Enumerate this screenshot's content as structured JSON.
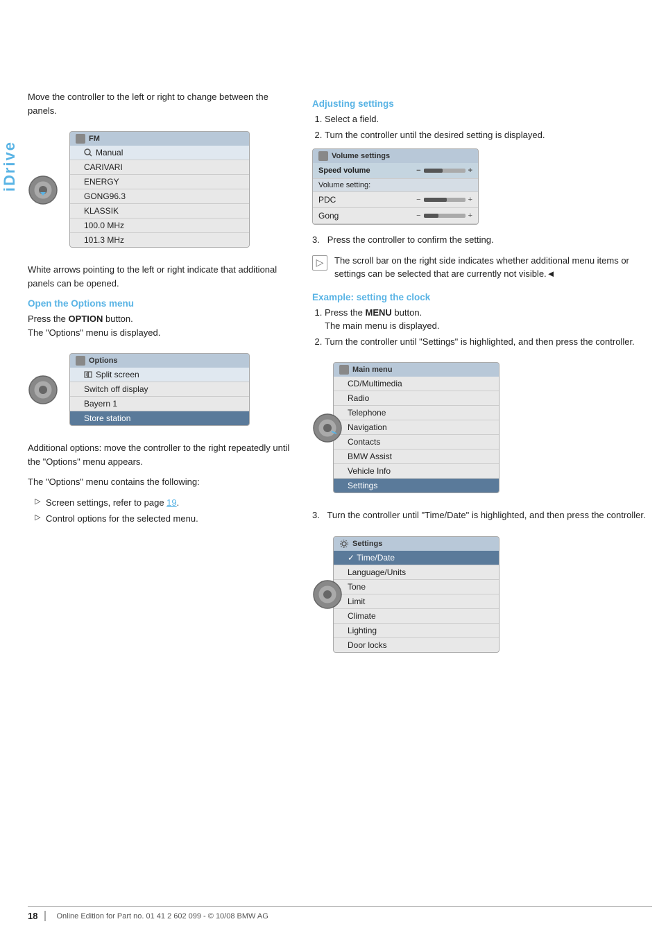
{
  "page": {
    "title": "iDrive",
    "page_number": "18",
    "footer_text": "Online Edition for Part no. 01 41 2 602 099 - © 10/08 BMW AG"
  },
  "left_col": {
    "intro_text": "Move the controller to the left or right to change between the panels.",
    "fm_screen": {
      "title": "FM",
      "rows": [
        {
          "label": "Manual",
          "type": "manual"
        },
        {
          "label": "CARIVARI",
          "type": "normal"
        },
        {
          "label": "ENERGY",
          "type": "normal"
        },
        {
          "label": "GONG96.3",
          "type": "normal"
        },
        {
          "label": "KLASSIK",
          "type": "normal"
        },
        {
          "label": "100.0 MHz",
          "type": "normal"
        },
        {
          "label": "101.3 MHz",
          "type": "normal"
        }
      ]
    },
    "arrows_text": "White arrows pointing to the left or right indicate that additional panels can be opened.",
    "options_section": {
      "heading": "Open the Options menu",
      "para1": "Press the OPTION button.",
      "para2": "The \"Options\" menu is displayed.",
      "options_screen": {
        "title": "Options",
        "rows": [
          {
            "label": "Split screen",
            "type": "icon-row"
          },
          {
            "label": "Switch off display",
            "type": "normal"
          },
          {
            "label": "Bayern 1",
            "type": "normal"
          },
          {
            "label": "Store station",
            "type": "highlighted"
          }
        ]
      },
      "additional_text": "Additional options: move the controller to the right repeatedly until the \"Options\" menu appears.",
      "contains_text": "The \"Options\" menu contains the following:",
      "bullet_items": [
        "Screen settings, refer to page 19.",
        "Control options for the selected menu."
      ]
    }
  },
  "right_col": {
    "adjusting_section": {
      "heading": "Adjusting settings",
      "steps": [
        "Select a field.",
        "Turn the controller until the desired setting is displayed."
      ],
      "volume_screen": {
        "title": "Volume settings",
        "speed_volume_label": "Speed volume",
        "volume_setting_label": "Volume setting:",
        "pdc_label": "PDC",
        "gong_label": "Gong"
      },
      "step3": "Press the controller to confirm the setting.",
      "scroll_note": "The scroll bar on the right side indicates whether additional menu items or settings can be selected that are currently not visible.◄"
    },
    "example_section": {
      "heading": "Example: setting the clock",
      "steps": [
        {
          "text": "Press the MENU button.",
          "sub": "The main menu is displayed."
        },
        {
          "text": "Turn the controller until \"Settings\" is highlighted, and then press the controller.",
          "sub": ""
        }
      ],
      "main_menu_screen": {
        "title": "Main menu",
        "rows": [
          {
            "label": "CD/Multimedia",
            "type": "normal"
          },
          {
            "label": "Radio",
            "type": "normal"
          },
          {
            "label": "Telephone",
            "type": "normal"
          },
          {
            "label": "Navigation",
            "type": "normal"
          },
          {
            "label": "Contacts",
            "type": "normal"
          },
          {
            "label": "BMW Assist",
            "type": "normal"
          },
          {
            "label": "Vehicle Info",
            "type": "normal"
          },
          {
            "label": "Settings",
            "type": "highlighted"
          }
        ]
      },
      "step3_text": "Turn the controller until \"Time/Date\" is highlighted, and then press the controller.",
      "settings_screen": {
        "title": "Settings",
        "rows": [
          {
            "label": "✓  Time/Date",
            "type": "highlighted"
          },
          {
            "label": "Language/Units",
            "type": "normal"
          },
          {
            "label": "Tone",
            "type": "normal"
          },
          {
            "label": "Limit",
            "type": "normal"
          },
          {
            "label": "Climate",
            "type": "normal"
          },
          {
            "label": "Lighting",
            "type": "normal"
          },
          {
            "label": "Door locks",
            "type": "normal"
          }
        ]
      }
    }
  }
}
